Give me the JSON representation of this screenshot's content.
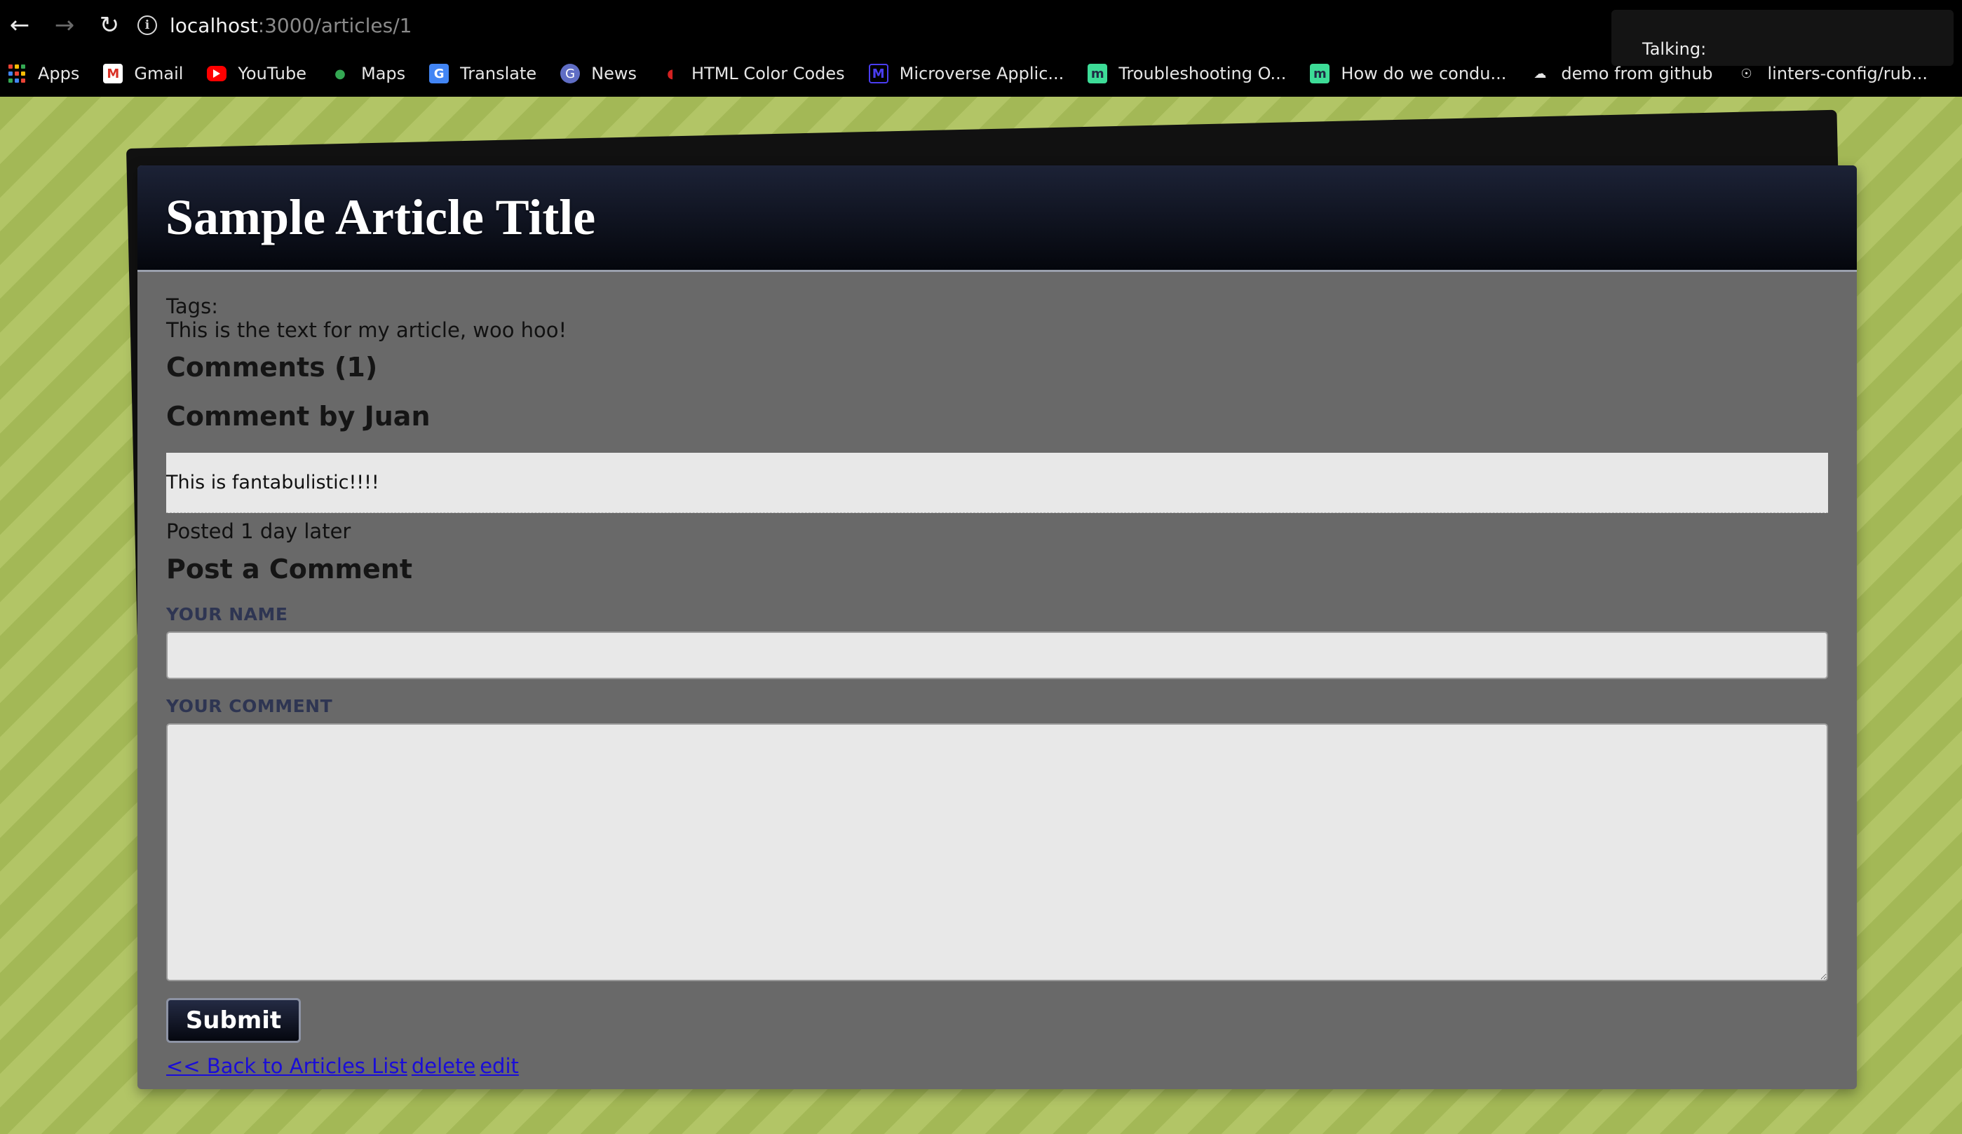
{
  "browser": {
    "url_host": "localhost",
    "url_path": ":3000/articles/1",
    "talking_label": "Talking:",
    "bookmarks": [
      {
        "label": "Apps",
        "icon": "apps-grid-icon"
      },
      {
        "label": "Gmail",
        "icon": "gmail-icon"
      },
      {
        "label": "YouTube",
        "icon": "youtube-icon"
      },
      {
        "label": "Maps",
        "icon": "maps-pin-icon"
      },
      {
        "label": "Translate",
        "icon": "translate-icon"
      },
      {
        "label": "News",
        "icon": "news-icon"
      },
      {
        "label": "HTML Color Codes",
        "icon": "color-codes-icon"
      },
      {
        "label": "Microverse Applic...",
        "icon": "microverse-icon"
      },
      {
        "label": "Troubleshooting O...",
        "icon": "m-icon"
      },
      {
        "label": "How do we condu...",
        "icon": "m-icon"
      },
      {
        "label": "demo from github",
        "icon": "cloud-icon"
      },
      {
        "label": "linters-config/rub...",
        "icon": "github-icon"
      }
    ]
  },
  "article": {
    "title": "Sample Article Title",
    "tags_label": "Tags:",
    "body": "This is the text for my article, woo hoo!",
    "comments_heading": "Comments (1)",
    "comments": [
      {
        "heading": "Comment by Juan",
        "body": "This is fantabulistic!!!!",
        "posted": "Posted 1 day later"
      }
    ]
  },
  "form": {
    "heading": "Post a Comment",
    "name_label": "YOUR NAME",
    "name_value": "",
    "comment_label": "YOUR COMMENT",
    "comment_value": "",
    "submit_label": "Submit"
  },
  "links": {
    "back": "<< Back to Articles List",
    "delete": "delete",
    "edit": "edit"
  },
  "colors": {
    "page_background": "#a9bb5a",
    "card_background": "#696969",
    "header_background": "#04060c",
    "link": "#1a0dd8"
  }
}
